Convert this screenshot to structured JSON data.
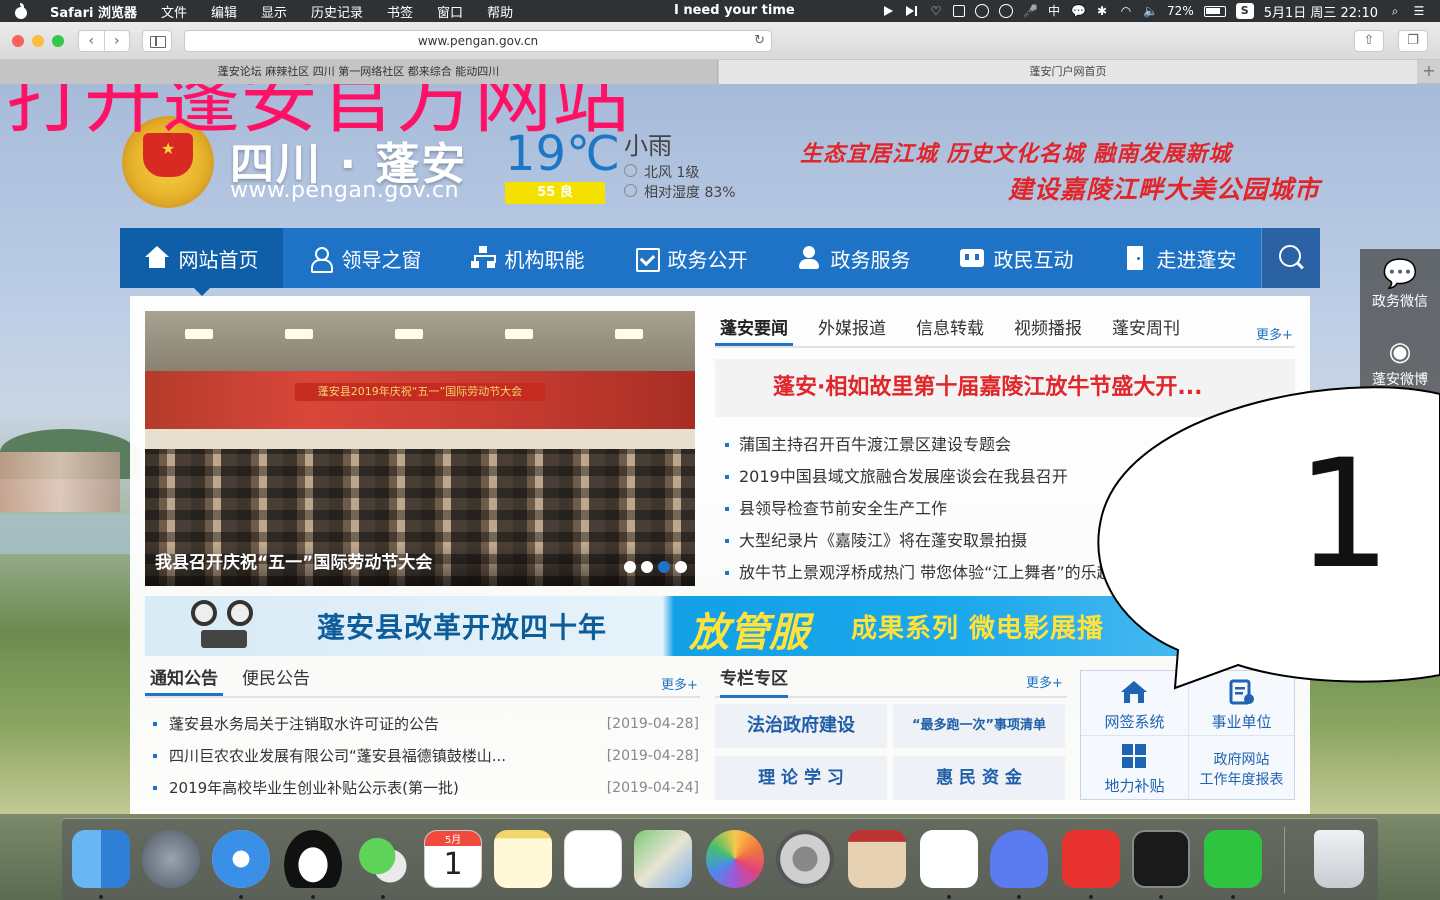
{
  "menubar": {
    "app": "Safari 浏览器",
    "menus": [
      "文件",
      "编辑",
      "显示",
      "历史记录",
      "书签",
      "窗口",
      "帮助"
    ],
    "now_playing": "I need your time",
    "input_method": "中",
    "battery": "72%",
    "datetime": "5月1日 周三 22:10"
  },
  "browser": {
    "url": "www.pengan.gov.cn",
    "tabs": [
      {
        "title": "蓬安论坛 麻辣社区 四川 第一网络社区 都来综合 能动四川"
      },
      {
        "title": "蓬安门户网首页"
      }
    ]
  },
  "overlay_title": "打开蓬安官方网站",
  "header": {
    "site_name": "四川 · 蓬安",
    "site_url": "www.pengan.gov.cn",
    "temperature": "19℃",
    "aqi": "55 良",
    "condition": "小雨",
    "wind": "北风 1级",
    "humidity": "相对湿度 83%",
    "slogan_line1": "生态宜居江城  历史文化名城  融南发展新城",
    "slogan_line2": "建设嘉陵江畔大美公园城市"
  },
  "nav": [
    {
      "label": "网站首页",
      "icon": "home-icon"
    },
    {
      "label": "领导之窗",
      "icon": "person-icon"
    },
    {
      "label": "机构职能",
      "icon": "org-chart-icon"
    },
    {
      "label": "政务公开",
      "icon": "document-icon"
    },
    {
      "label": "政务服务",
      "icon": "service-icon"
    },
    {
      "label": "政民互动",
      "icon": "chat-icon"
    },
    {
      "label": "走进蓬安",
      "icon": "door-icon"
    }
  ],
  "photo": {
    "caption": "我县召开庆祝“五一”国际劳动节大会",
    "banner_text": "蓬安县2019年庆祝“五一”国际劳动节大会"
  },
  "news": {
    "tabs": [
      "蓬安要闻",
      "外媒报道",
      "信息转载",
      "视频播报",
      "蓬安周刊"
    ],
    "more": "更多+",
    "headline": "蓬安·相如故里第十届嘉陵江放牛节盛大开...",
    "items": [
      "蒲国主持召开百牛渡江景区建设专题会",
      "2019中国县域文旅融合发展座谈会在我县召开",
      "县领导检查节前安全生产工作",
      "大型纪录片《嘉陵江》将在蓬安取景拍摄",
      "放牛节上景观浮桥成热门 带您体验“江上舞者”的乐趣"
    ]
  },
  "ad_banner": {
    "text1": "蓬安县改革开放四十年",
    "text2": "放管服",
    "text3": "成果系列 微电影展播"
  },
  "notices": {
    "tabs": [
      "通知公告",
      "便民公告"
    ],
    "more": "更多+",
    "items": [
      {
        "title": "蓬安县水务局关于注销取水许可证的公告",
        "date": "[2019-04-28]"
      },
      {
        "title": "四川巨农农业发展有限公司“蓬安县福德镇鼓楼山...",
        "date": "[2019-04-28]"
      },
      {
        "title": "2019年高校毕业生创业补贴公示表(第一批)",
        "date": "[2019-04-24]"
      }
    ]
  },
  "special": {
    "title": "专栏专区",
    "more": "更多+",
    "buttons": [
      "法治政府建设",
      "“最多跑一次”事项清单",
      "理 论 学 习",
      "惠 民 资 金"
    ]
  },
  "quick_links": [
    {
      "label": "网签系统",
      "icon": "house-icon"
    },
    {
      "label": "事业单位",
      "icon": "register-icon"
    },
    {
      "label": "地力补贴",
      "icon": "grid-icon"
    },
    {
      "label": "政府网站工作年度报表",
      "line1": "政府网站",
      "line2": "工作年度报表"
    }
  ],
  "float": {
    "wechat": "政务微信",
    "weibo": "蓬安微博"
  },
  "bubble_number": "1",
  "dock": [
    "finder-icon",
    "launchpad-icon",
    "safari-icon",
    "qq-icon",
    "wechat-icon",
    "calendar-icon",
    "notes-icon",
    "reminders-icon",
    "maps-icon",
    "photos-icon",
    "system-preferences-icon",
    "photo-booth-icon",
    "baidu-netdisk-icon",
    "wps-icon",
    "netease-music-icon",
    "activity-monitor-icon",
    "iqiyi-icon",
    "trash-icon"
  ],
  "calendar_month": "5月",
  "calendar_day": "1",
  "colors": {
    "nav_blue": "#1f73c6",
    "headline_red": "#e0262a",
    "overlay_pink": "#ff1166"
  }
}
